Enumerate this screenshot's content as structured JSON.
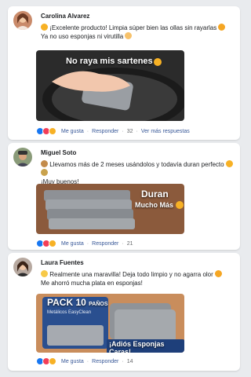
{
  "comments": [
    {
      "author": "Carolina Alvarez",
      "text_lines": [
        "¡Excelente producto! Limpia súper bien las ollas sin rayarlas",
        "Ya no uso esponjas ni virutilla"
      ],
      "image_caption": "No raya mis sartenes",
      "actions": {
        "like": "Me gusta",
        "reply": "Responder",
        "count": "32",
        "more": "Ver más respuestas"
      }
    },
    {
      "author": "Miguel Soto",
      "text_lines": [
        "Llevamos más de 2 meses usándolos y todavía duran perfecto",
        "¡Muy buenos!"
      ],
      "image_caption_lines": [
        "Duran",
        "Mucho Más"
      ],
      "actions": {
        "like": "Me gusta",
        "reply": "Responder",
        "count": "21"
      }
    },
    {
      "author": "Laura Fuentes",
      "text_lines": [
        "Realmente una maravilla! Deja todo limpio y no agarra olor",
        "Me ahorró mucha plata en esponjas!"
      ],
      "image_pack": {
        "line1": "PACK 10",
        "line1_suffix": "PAÑOS",
        "line2": "Metálicos EasyClean",
        "banner": "¡Adiós Esponjas Caras!"
      },
      "actions": {
        "like": "Me gusta",
        "reply": "Responder",
        "count": "14"
      }
    }
  ],
  "colors": {
    "background": "#e9ebee",
    "card": "#ffffff",
    "link": "#385898",
    "like_blue": "#1877f2",
    "love_red": "#f33e58",
    "haha_yellow": "#f7b125"
  },
  "icons": [
    "thumbs-up-emoji",
    "heart-eyes-emoji",
    "ok-hand-emoji",
    "hourglass-emoji",
    "flexed-biceps-emoji",
    "money-bag-emoji",
    "sparkles-emoji",
    "pointing-hand-emoji"
  ]
}
